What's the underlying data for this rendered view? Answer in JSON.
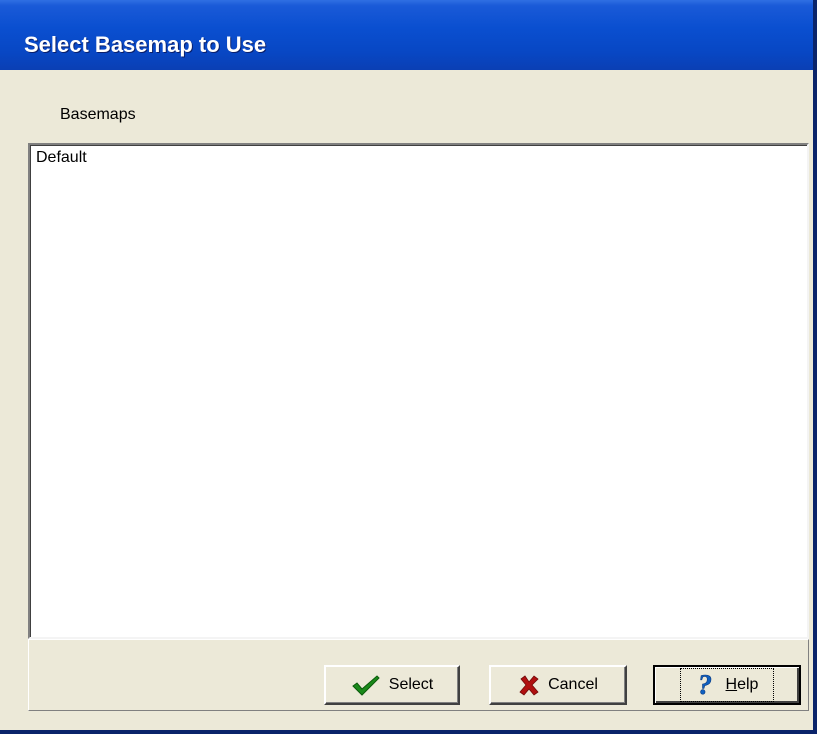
{
  "window": {
    "title": "Select Basemap to Use"
  },
  "list": {
    "label": "Basemaps",
    "items": [
      "Default"
    ]
  },
  "buttons": {
    "select_label": "Select",
    "cancel_label": "Cancel",
    "help_label": "Help",
    "help_mnemonic": "H",
    "help_rest": "elp"
  },
  "icons": {
    "select": "checkmark-icon",
    "cancel": "x-mark-icon",
    "help": "question-mark-icon"
  },
  "colors": {
    "title_bar": "#0a4fd0",
    "window_bg": "#ece9d8",
    "check_green": "#1a8a1a",
    "cancel_red": "#b01010",
    "help_blue": "#1060c0"
  }
}
